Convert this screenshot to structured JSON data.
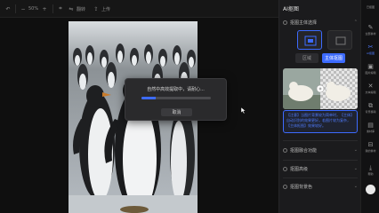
{
  "toolbar": {
    "back_icon": "undo-icon",
    "zoom": "50%",
    "flip_label": "翻转",
    "upload_label": "上传"
  },
  "modal": {
    "message": "自然中高效提取中，请耐心...",
    "progress": 0.2,
    "cancel_label": "取消"
  },
  "panel": {
    "title": "AI抠图",
    "section1": "抠图主体选择",
    "seg_left": "区域",
    "seg_right": "主体抠图",
    "note": "【注意】当图片背景较为简单时，【主体】自动识别的效果更好。若图片较为复杂，【主体抠图】效果较好。",
    "section2": "抠图融合功能",
    "section3": "抠图高级",
    "section4": "抠图背景色"
  },
  "rail": {
    "top_label": "已抠图",
    "items": [
      "全部素材",
      "AI抠图",
      "图片编辑",
      "文本编辑",
      "背景移除",
      "素材库",
      "我的素材"
    ],
    "bottom_label": "帮助"
  },
  "colors": {
    "accent": "#3d6bff",
    "panel_bg": "#1b1b1d",
    "modal_bg": "#2a2a2c"
  }
}
